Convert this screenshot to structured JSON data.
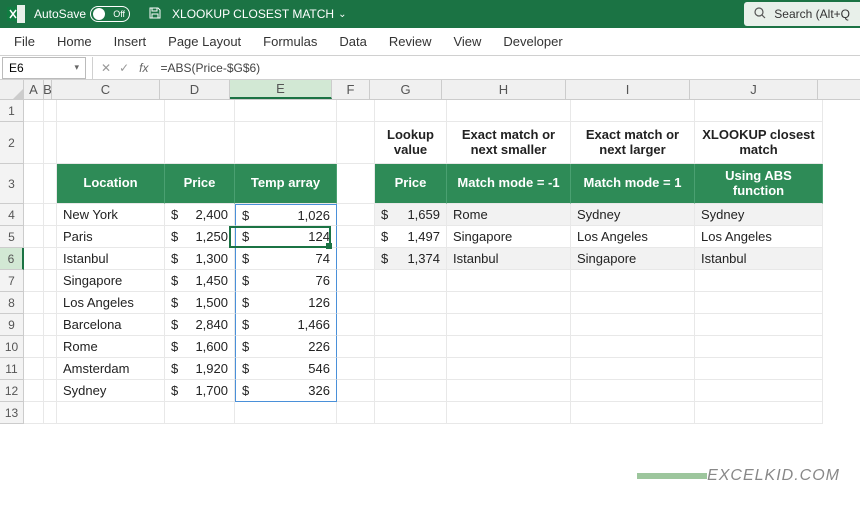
{
  "titlebar": {
    "autosave_label": "AutoSave",
    "toggle_off": "Off",
    "filename": "XLOOKUP CLOSEST MATCH",
    "search_label": "Search (Alt+Q"
  },
  "ribbon": {
    "file": "File",
    "home": "Home",
    "insert": "Insert",
    "page_layout": "Page Layout",
    "formulas": "Formulas",
    "data": "Data",
    "review": "Review",
    "view": "View",
    "developer": "Developer"
  },
  "namebox": {
    "ref": "E6"
  },
  "formula": {
    "text": "=ABS(Price-$G$6)"
  },
  "columns": [
    "A",
    "B",
    "C",
    "D",
    "E",
    "F",
    "G",
    "H",
    "I",
    "J"
  ],
  "rows_visible": [
    "1",
    "2",
    "3",
    "4",
    "5",
    "6",
    "7",
    "8",
    "9",
    "10",
    "11",
    "12",
    "13"
  ],
  "headers_row2": {
    "G": "Lookup value",
    "H": "Exact match or next smaller",
    "I": "Exact match or next larger",
    "J": "XLOOKUP closest match"
  },
  "headers_row3": {
    "C": "Location",
    "D": "Price",
    "E": "Temp array",
    "G": "Price",
    "H": "Match mode = -1",
    "I": "Match mode = 1",
    "J": "Using ABS function"
  },
  "table_left": [
    {
      "loc": "New York",
      "price": "2,400",
      "tmp": "1,026"
    },
    {
      "loc": "Paris",
      "price": "1,250",
      "tmp": "124"
    },
    {
      "loc": "Istanbul",
      "price": "1,300",
      "tmp": "74"
    },
    {
      "loc": "Singapore",
      "price": "1,450",
      "tmp": "76"
    },
    {
      "loc": "Los Angeles",
      "price": "1,500",
      "tmp": "126"
    },
    {
      "loc": "Barcelona",
      "price": "2,840",
      "tmp": "1,466"
    },
    {
      "loc": "Rome",
      "price": "1,600",
      "tmp": "226"
    },
    {
      "loc": "Amsterdam",
      "price": "1,920",
      "tmp": "546"
    },
    {
      "loc": "Sydney",
      "price": "1,700",
      "tmp": "326"
    }
  ],
  "table_right": [
    {
      "g": "1,659",
      "h": "Rome",
      "i": "Sydney",
      "j": "Sydney"
    },
    {
      "g": "1,497",
      "h": "Singapore",
      "i": "Los Angeles",
      "j": "Los Angeles"
    },
    {
      "g": "1,374",
      "h": "Istanbul",
      "i": "Singapore",
      "j": "Istanbul"
    }
  ],
  "watermark": "EXCELKID.COM",
  "chart_data": {
    "type": "table",
    "title": "XLOOKUP CLOSEST MATCH",
    "left_table": {
      "columns": [
        "Location",
        "Price",
        "Temp array"
      ],
      "rows": [
        [
          "New York",
          2400,
          1026
        ],
        [
          "Paris",
          1250,
          124
        ],
        [
          "Istanbul",
          1300,
          74
        ],
        [
          "Singapore",
          1450,
          76
        ],
        [
          "Los Angeles",
          1500,
          126
        ],
        [
          "Barcelona",
          2840,
          1466
        ],
        [
          "Rome",
          1600,
          226
        ],
        [
          "Amsterdam",
          1920,
          546
        ],
        [
          "Sydney",
          1700,
          326
        ]
      ]
    },
    "right_table": {
      "columns": [
        "Lookup value Price",
        "Exact match or next smaller (Match mode = -1)",
        "Exact match or next larger (Match mode = 1)",
        "XLOOKUP closest match (Using ABS function)"
      ],
      "rows": [
        [
          1659,
          "Rome",
          "Sydney",
          "Sydney"
        ],
        [
          1497,
          "Singapore",
          "Los Angeles",
          "Los Angeles"
        ],
        [
          1374,
          "Istanbul",
          "Singapore",
          "Istanbul"
        ]
      ]
    }
  }
}
